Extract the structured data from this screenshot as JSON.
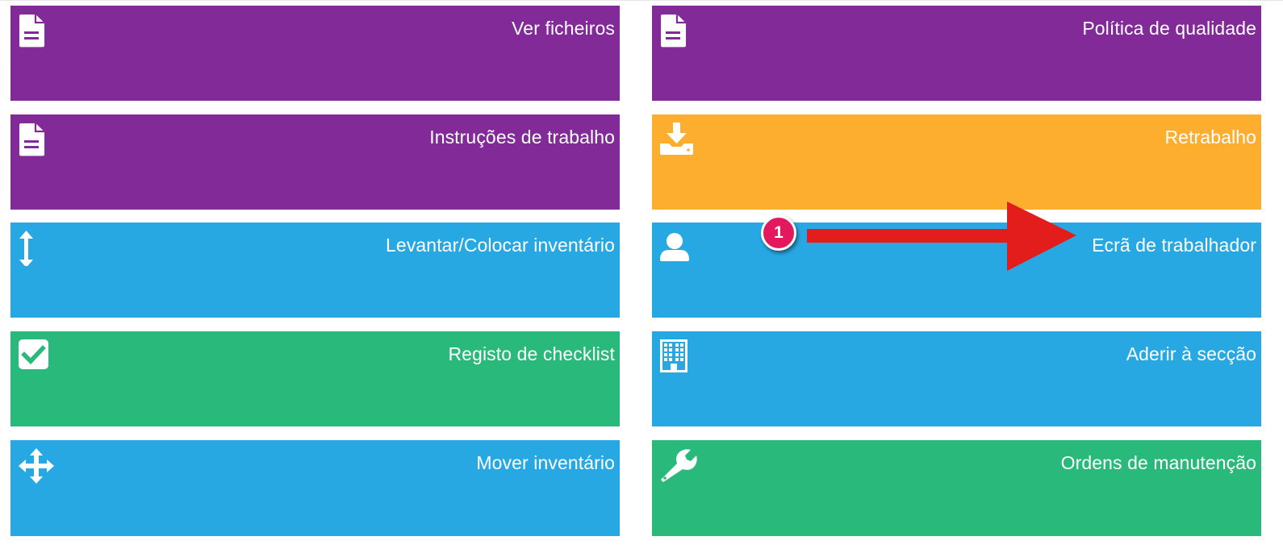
{
  "colors": {
    "purple": "#822a98",
    "orange": "#fdae2e",
    "blue": "#28a8e3",
    "green": "#29b97a",
    "annotation_red": "#e31c1c",
    "badge_pink": "#e4185c"
  },
  "tiles": [
    {
      "label": "Ver ficheiros",
      "icon": "file-text-icon",
      "color": "purple"
    },
    {
      "label": "Política de qualidade",
      "icon": "file-text-icon",
      "color": "purple"
    },
    {
      "label": "Instruções de trabalho",
      "icon": "file-text-icon",
      "color": "purple"
    },
    {
      "label": "Retrabalho",
      "icon": "download-tray-icon",
      "color": "orange"
    },
    {
      "label": "Levantar/Colocar inventário",
      "icon": "vertical-arrows-icon",
      "color": "blue"
    },
    {
      "label": "Ecrã de trabalhador",
      "icon": "user-icon",
      "color": "blue"
    },
    {
      "label": "Registo de checklist",
      "icon": "checkbox-icon",
      "color": "green"
    },
    {
      "label": "Aderir à secção",
      "icon": "building-icon",
      "color": "blue"
    },
    {
      "label": "Mover inventário",
      "icon": "move-arrows-icon",
      "color": "blue"
    },
    {
      "label": "Ordens de manutenção",
      "icon": "wrench-icon",
      "color": "green"
    }
  ],
  "annotation": {
    "step_number": "1",
    "arrow_icon": "arrow-right-icon"
  }
}
